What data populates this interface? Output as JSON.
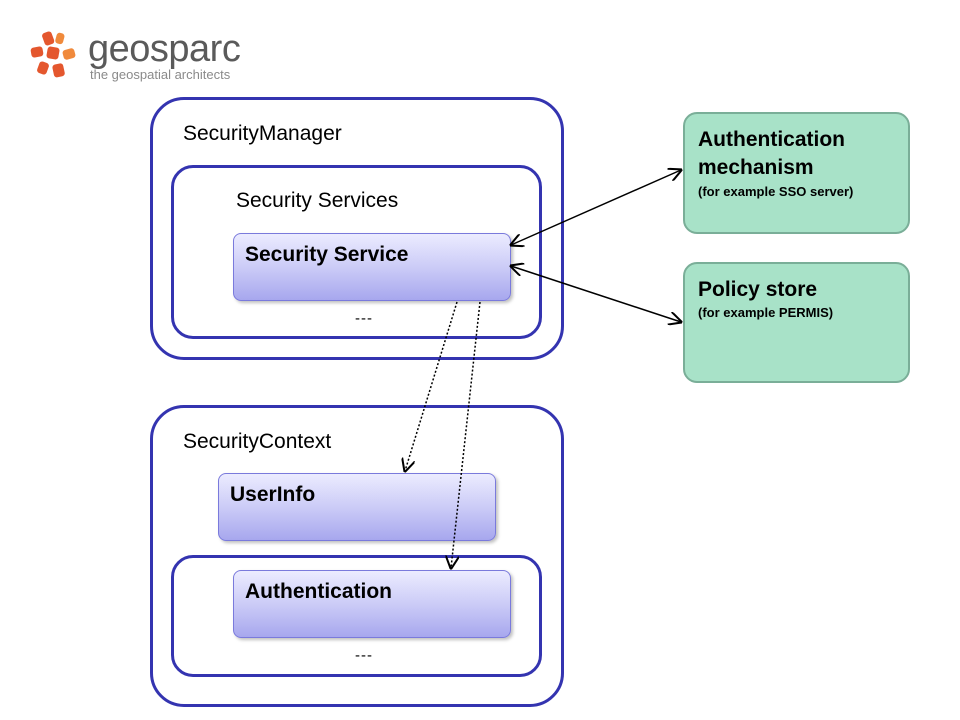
{
  "logo": {
    "name": "geosparc",
    "tagline": "the geospatial architects",
    "accent_color": "#e4572e"
  },
  "security_manager": {
    "title": "SecurityManager",
    "services": {
      "title": "Security Services",
      "service_label": "Security Service",
      "ellipsis": "---"
    }
  },
  "security_context": {
    "title": "SecurityContext",
    "user_info_label": "UserInfo",
    "authentication_label": "Authentication",
    "ellipsis": "---"
  },
  "external": {
    "auth_mechanism": {
      "title": "Authentication mechanism",
      "subtitle": "(for example SSO server)"
    },
    "policy_store": {
      "title": "Policy store",
      "subtitle": "(for example PERMIS)"
    }
  },
  "colors": {
    "container_border": "#3434b0",
    "service_fill": "#c8c8f6",
    "external_fill": "#a8e2c8",
    "external_border": "#7aae98"
  }
}
